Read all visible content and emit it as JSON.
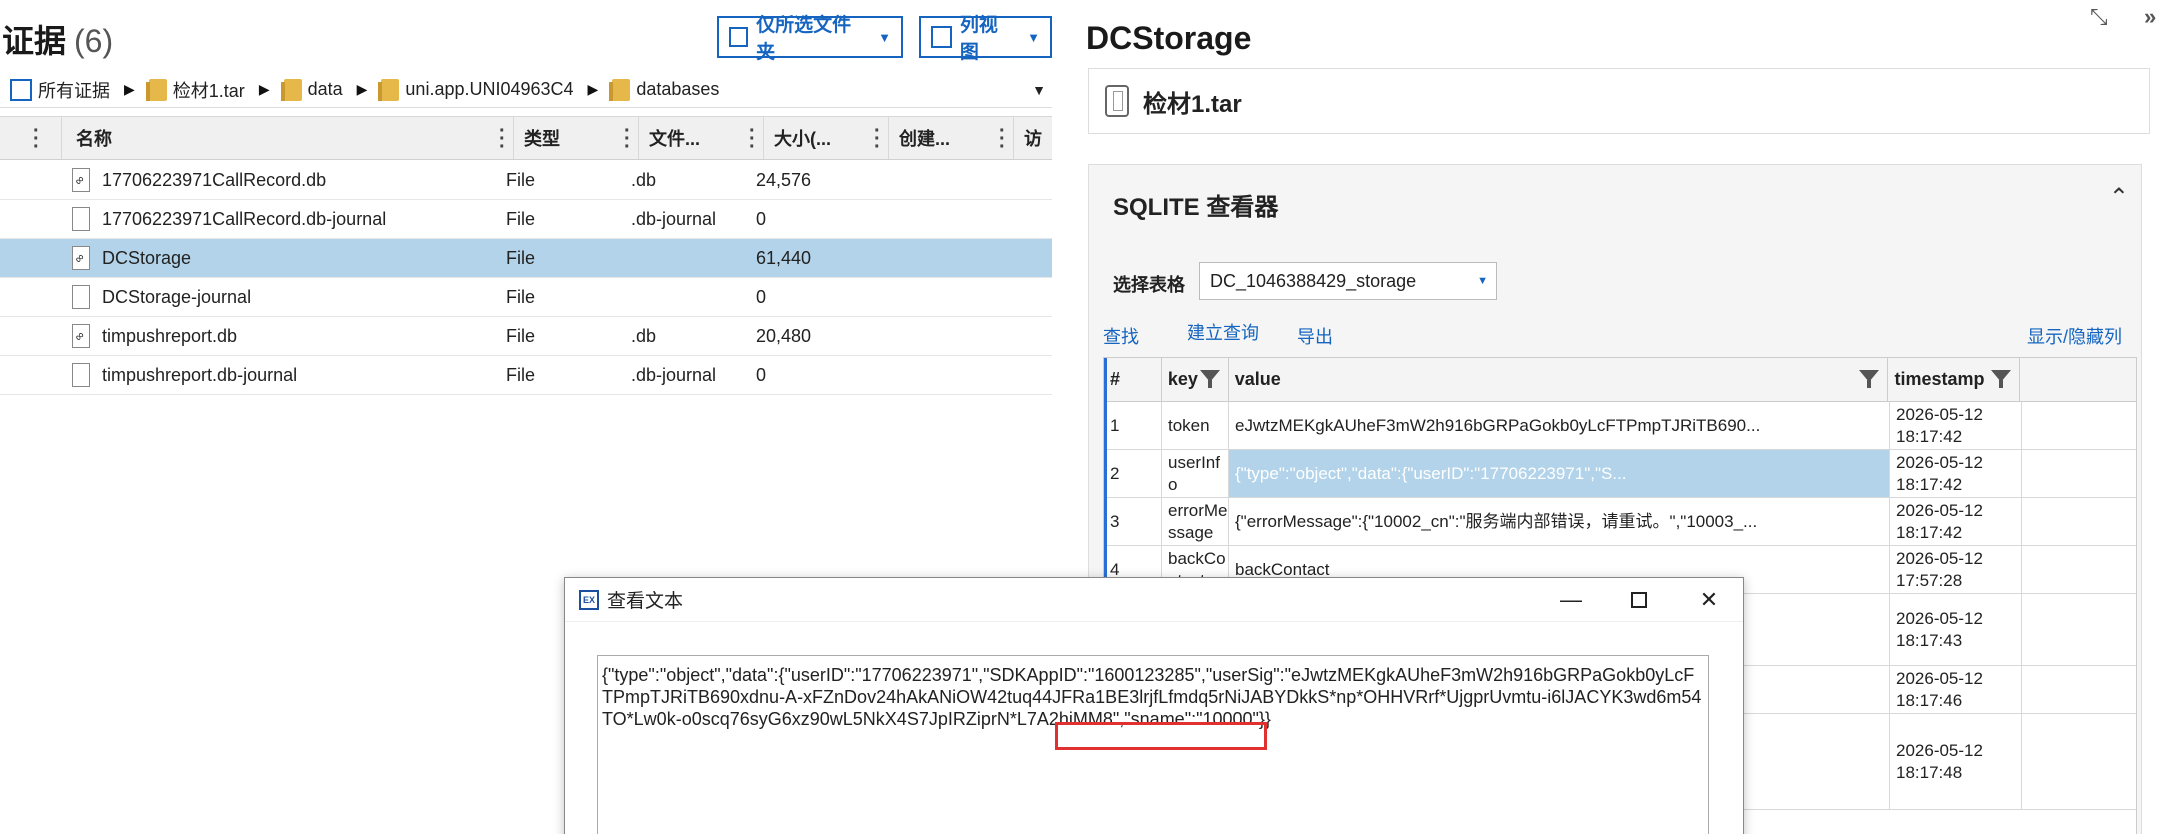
{
  "evidence": {
    "title": "证据",
    "count": "(6)",
    "filter_button": "仅所选文件夹",
    "view_button": "列视图"
  },
  "breadcrumb": [
    "所有证据",
    "检材1.tar",
    "data",
    "uni.app.UNI04963C4",
    "databases"
  ],
  "file_grid": {
    "columns": [
      "名称",
      "类型",
      "文件...",
      "大小(...",
      "创建...",
      "访"
    ],
    "rows": [
      {
        "name": "17706223971CallRecord.db",
        "type": "File",
        "ext": ".db",
        "size": "24,576",
        "icon": "db-file-icon"
      },
      {
        "name": "17706223971CallRecord.db-journal",
        "type": "File",
        "ext": ".db-journal",
        "size": "0",
        "icon": "file-icon"
      },
      {
        "name": "DCStorage",
        "type": "File",
        "ext": "",
        "size": "61,440",
        "icon": "db-file-icon",
        "selected": true
      },
      {
        "name": "DCStorage-journal",
        "type": "File",
        "ext": "",
        "size": "0",
        "icon": "file-icon"
      },
      {
        "name": "timpushreport.db",
        "type": "File",
        "ext": ".db",
        "size": "20,480",
        "icon": "db-file-icon"
      },
      {
        "name": "timpushreport.db-journal",
        "type": "File",
        "ext": ".db-journal",
        "size": "0",
        "icon": "file-icon"
      }
    ]
  },
  "right": {
    "title": "DCStorage",
    "source": "检材1.tar",
    "viewer_title": "SQLITE 查看器",
    "select_label": "选择表格",
    "select_value": "DC_1046388429_storage",
    "links": {
      "find": "查找",
      "query": "建立查询",
      "export": "导出",
      "toggle_cols": "显示/隐藏列"
    },
    "columns": [
      "#",
      "key",
      "value",
      "timestamp"
    ],
    "rows": [
      {
        "n": "1",
        "key": "token",
        "value": "eJwtzMEKgkAUheF3mW2h916bGRPaGokb0yLcFTPmpTJRiTB690...",
        "ts": "2026-05-12 18:17:42"
      },
      {
        "n": "2",
        "key": "userInfo",
        "value": "{\"type\":\"object\",\"data\":{\"userID\":\"17706223971\",\"S...",
        "ts": "2026-05-12 18:17:42",
        "selected": true
      },
      {
        "n": "3",
        "key": "errorMessage",
        "value": "{\"errorMessage\":{\"10002_cn\":\"服务端内部错误，请重试。\",\"10003_...",
        "ts": "2026-05-12 18:17:42"
      },
      {
        "n": "4",
        "key": "backContact",
        "value": "backContact",
        "ts": "2026-05-12 17:57:28"
      },
      {
        "n": "",
        "key": "",
        "value": "",
        "ts": "2026-05-12 18:17:43"
      },
      {
        "n": "",
        "key": "",
        "value": "",
        "ts": "2026-05-12 18:17:46"
      },
      {
        "n": "",
        "key": "",
        "value": "",
        "ts": "2026-05-12 18:17:48"
      }
    ]
  },
  "dialog": {
    "title": "查看文本",
    "text_main": "{\"type\":\"object\",\"data\":{\"userID\":\"17706223971\",\"SDKAppID\":\"1600123285\",\"userSig\":\"eJwtzMEKgkAUheF3mW2h916bGRPaGokb0yLcFTPmpTJRiTB690xdnu-A-xFZnDov24hAkANiOW42tuq44JFRa1BE3lrjfLfmdq5rNiJABYDkkS*np*OHHVRrf*UjgprUvmtu-i6lJACYK3wd6m54TO*Lw0k-o0scq76syG6xz90wL5NkX4S7JpIRZiprN*L7A2hiMM8",
    "text_highlight": "\",\"sname\":\"10000\"}}"
  }
}
